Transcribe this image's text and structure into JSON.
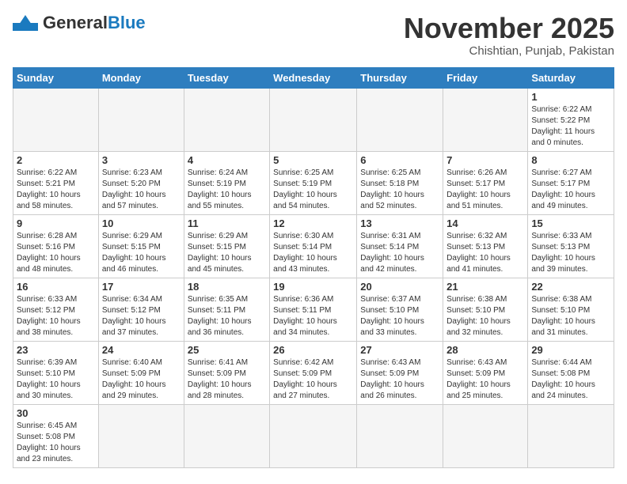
{
  "header": {
    "logo_general": "General",
    "logo_blue": "Blue",
    "title": "November 2025",
    "location": "Chishtian, Punjab, Pakistan"
  },
  "calendar": {
    "days_of_week": [
      "Sunday",
      "Monday",
      "Tuesday",
      "Wednesday",
      "Thursday",
      "Friday",
      "Saturday"
    ],
    "weeks": [
      [
        {
          "day": "",
          "info": ""
        },
        {
          "day": "",
          "info": ""
        },
        {
          "day": "",
          "info": ""
        },
        {
          "day": "",
          "info": ""
        },
        {
          "day": "",
          "info": ""
        },
        {
          "day": "",
          "info": ""
        },
        {
          "day": "1",
          "info": "Sunrise: 6:22 AM\nSunset: 5:22 PM\nDaylight: 11 hours\nand 0 minutes."
        }
      ],
      [
        {
          "day": "2",
          "info": "Sunrise: 6:22 AM\nSunset: 5:21 PM\nDaylight: 10 hours\nand 58 minutes."
        },
        {
          "day": "3",
          "info": "Sunrise: 6:23 AM\nSunset: 5:20 PM\nDaylight: 10 hours\nand 57 minutes."
        },
        {
          "day": "4",
          "info": "Sunrise: 6:24 AM\nSunset: 5:19 PM\nDaylight: 10 hours\nand 55 minutes."
        },
        {
          "day": "5",
          "info": "Sunrise: 6:25 AM\nSunset: 5:19 PM\nDaylight: 10 hours\nand 54 minutes."
        },
        {
          "day": "6",
          "info": "Sunrise: 6:25 AM\nSunset: 5:18 PM\nDaylight: 10 hours\nand 52 minutes."
        },
        {
          "day": "7",
          "info": "Sunrise: 6:26 AM\nSunset: 5:17 PM\nDaylight: 10 hours\nand 51 minutes."
        },
        {
          "day": "8",
          "info": "Sunrise: 6:27 AM\nSunset: 5:17 PM\nDaylight: 10 hours\nand 49 minutes."
        }
      ],
      [
        {
          "day": "9",
          "info": "Sunrise: 6:28 AM\nSunset: 5:16 PM\nDaylight: 10 hours\nand 48 minutes."
        },
        {
          "day": "10",
          "info": "Sunrise: 6:29 AM\nSunset: 5:15 PM\nDaylight: 10 hours\nand 46 minutes."
        },
        {
          "day": "11",
          "info": "Sunrise: 6:29 AM\nSunset: 5:15 PM\nDaylight: 10 hours\nand 45 minutes."
        },
        {
          "day": "12",
          "info": "Sunrise: 6:30 AM\nSunset: 5:14 PM\nDaylight: 10 hours\nand 43 minutes."
        },
        {
          "day": "13",
          "info": "Sunrise: 6:31 AM\nSunset: 5:14 PM\nDaylight: 10 hours\nand 42 minutes."
        },
        {
          "day": "14",
          "info": "Sunrise: 6:32 AM\nSunset: 5:13 PM\nDaylight: 10 hours\nand 41 minutes."
        },
        {
          "day": "15",
          "info": "Sunrise: 6:33 AM\nSunset: 5:13 PM\nDaylight: 10 hours\nand 39 minutes."
        }
      ],
      [
        {
          "day": "16",
          "info": "Sunrise: 6:33 AM\nSunset: 5:12 PM\nDaylight: 10 hours\nand 38 minutes."
        },
        {
          "day": "17",
          "info": "Sunrise: 6:34 AM\nSunset: 5:12 PM\nDaylight: 10 hours\nand 37 minutes."
        },
        {
          "day": "18",
          "info": "Sunrise: 6:35 AM\nSunset: 5:11 PM\nDaylight: 10 hours\nand 36 minutes."
        },
        {
          "day": "19",
          "info": "Sunrise: 6:36 AM\nSunset: 5:11 PM\nDaylight: 10 hours\nand 34 minutes."
        },
        {
          "day": "20",
          "info": "Sunrise: 6:37 AM\nSunset: 5:10 PM\nDaylight: 10 hours\nand 33 minutes."
        },
        {
          "day": "21",
          "info": "Sunrise: 6:38 AM\nSunset: 5:10 PM\nDaylight: 10 hours\nand 32 minutes."
        },
        {
          "day": "22",
          "info": "Sunrise: 6:38 AM\nSunset: 5:10 PM\nDaylight: 10 hours\nand 31 minutes."
        }
      ],
      [
        {
          "day": "23",
          "info": "Sunrise: 6:39 AM\nSunset: 5:10 PM\nDaylight: 10 hours\nand 30 minutes."
        },
        {
          "day": "24",
          "info": "Sunrise: 6:40 AM\nSunset: 5:09 PM\nDaylight: 10 hours\nand 29 minutes."
        },
        {
          "day": "25",
          "info": "Sunrise: 6:41 AM\nSunset: 5:09 PM\nDaylight: 10 hours\nand 28 minutes."
        },
        {
          "day": "26",
          "info": "Sunrise: 6:42 AM\nSunset: 5:09 PM\nDaylight: 10 hours\nand 27 minutes."
        },
        {
          "day": "27",
          "info": "Sunrise: 6:43 AM\nSunset: 5:09 PM\nDaylight: 10 hours\nand 26 minutes."
        },
        {
          "day": "28",
          "info": "Sunrise: 6:43 AM\nSunset: 5:09 PM\nDaylight: 10 hours\nand 25 minutes."
        },
        {
          "day": "29",
          "info": "Sunrise: 6:44 AM\nSunset: 5:08 PM\nDaylight: 10 hours\nand 24 minutes."
        }
      ],
      [
        {
          "day": "30",
          "info": "Sunrise: 6:45 AM\nSunset: 5:08 PM\nDaylight: 10 hours\nand 23 minutes."
        },
        {
          "day": "",
          "info": ""
        },
        {
          "day": "",
          "info": ""
        },
        {
          "day": "",
          "info": ""
        },
        {
          "day": "",
          "info": ""
        },
        {
          "day": "",
          "info": ""
        },
        {
          "day": "",
          "info": ""
        }
      ]
    ]
  }
}
